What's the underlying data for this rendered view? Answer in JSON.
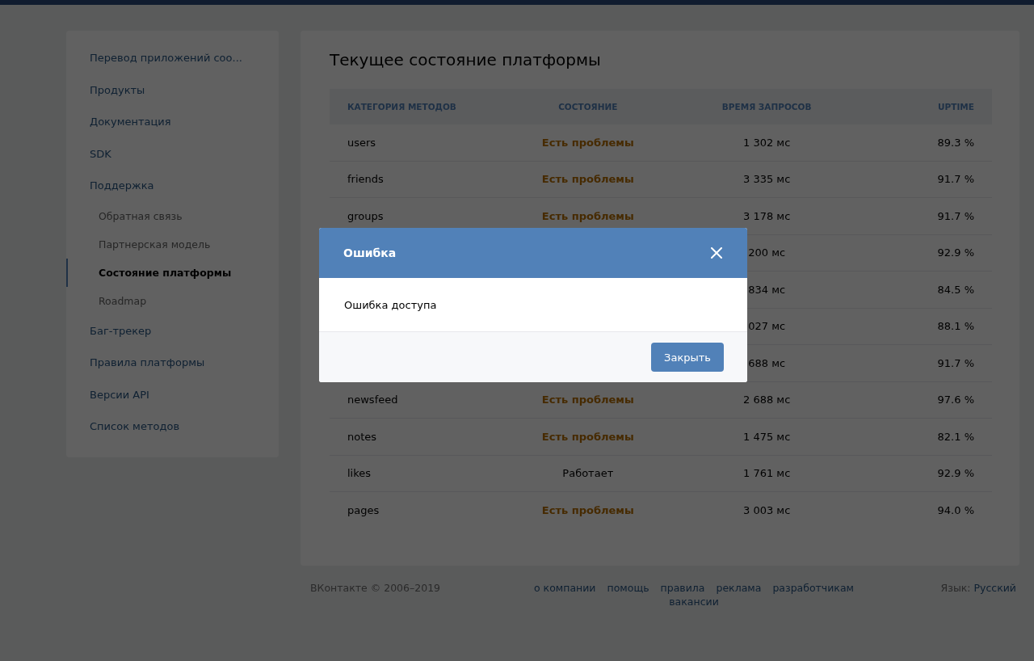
{
  "sidebar": {
    "items": [
      {
        "label": "Перевод приложений соо...",
        "selected": false
      },
      {
        "label": "Продукты",
        "selected": false
      },
      {
        "label": "Документация",
        "selected": false
      },
      {
        "label": "SDK",
        "selected": false
      },
      {
        "label": "Поддержка",
        "selected": false,
        "children": [
          {
            "label": "Обратная связь",
            "selected": false
          },
          {
            "label": "Партнерская модель",
            "selected": false
          },
          {
            "label": "Состояние платформы",
            "selected": true
          },
          {
            "label": "Roadmap",
            "selected": false
          }
        ]
      },
      {
        "label": "Баг-трекер",
        "selected": false
      },
      {
        "label": "Правила платформы",
        "selected": false
      },
      {
        "label": "Версии API",
        "selected": false
      },
      {
        "label": "Список методов",
        "selected": false
      }
    ]
  },
  "main": {
    "title": "Текущее состояние платформы",
    "table": {
      "columns": [
        "КАТЕГОРИЯ МЕТОДОВ",
        "СОСТОЯНИЕ",
        "ВРЕМЯ ЗАПРОСОВ",
        "UPTIME"
      ],
      "rows": [
        {
          "category": "users",
          "status": {
            "text": "Есть проблемы",
            "kind": "problem"
          },
          "time": "1 302 мс",
          "uptime": "89.3 %"
        },
        {
          "category": "friends",
          "status": {
            "text": "Есть проблемы",
            "kind": "problem"
          },
          "time": "3 335 мс",
          "uptime": "91.7 %"
        },
        {
          "category": "groups",
          "status": {
            "text": "Есть проблемы",
            "kind": "problem"
          },
          "time": "3 178 мс",
          "uptime": "91.7 %"
        },
        {
          "time": "200 мс",
          "uptime": "92.9 %"
        },
        {
          "time": "834 мс",
          "uptime": "84.5 %"
        },
        {
          "time": "027 мс",
          "uptime": "88.1 %"
        },
        {
          "time": "688 мс",
          "uptime": "91.7 %"
        },
        {
          "category": "newsfeed",
          "status": {
            "text": "Есть проблемы",
            "kind": "problem"
          },
          "time": "2 688 мс",
          "uptime": "97.6 %"
        },
        {
          "category": "notes",
          "status": {
            "text": "Есть проблемы",
            "kind": "problem"
          },
          "time": "1 475 мс",
          "uptime": "82.1 %"
        },
        {
          "category": "likes",
          "status": {
            "text": "Работает",
            "kind": "ok"
          },
          "time": "1 761 мс",
          "uptime": "92.9 %"
        },
        {
          "category": "pages",
          "status": {
            "text": "Есть проблемы",
            "kind": "problem"
          },
          "time": "3 003 мс",
          "uptime": "94.0 %"
        }
      ]
    }
  },
  "footer": {
    "copyright": "ВКонтакте © 2006–2019",
    "links": [
      "о компании",
      "помощь",
      "правила",
      "реклама",
      "разработчикам",
      "вакансии"
    ],
    "language_label": "Язык:",
    "language": "Русский"
  },
  "dialog": {
    "title": "Ошибка",
    "message": "Ошибка доступа",
    "button": "Закрыть"
  }
}
